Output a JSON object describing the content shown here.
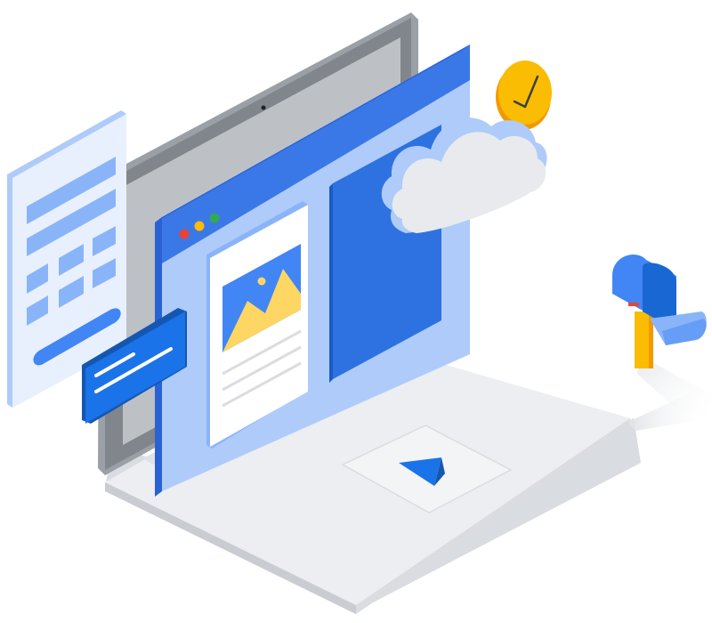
{
  "scene": {
    "subject": "isometric-laptop-illustration",
    "objects": [
      "laptop",
      "browser-window",
      "image-card",
      "cloud",
      "clock",
      "form-panel",
      "message-card",
      "mailbox",
      "touchpad-play-button"
    ]
  },
  "palette": {
    "background": "#ffffff",
    "laptop_base": "#eceef1",
    "laptop_base_shadow": "#d9dce1",
    "screen_bezel": "#80868b",
    "screen_bezel_light": "#bdc1c6",
    "window_frame": "#3b78e7",
    "window_frame_dark": "#2a62d4",
    "window_light": "#aecbfa",
    "card_white": "#ffffff",
    "image_blue": "#4285f4",
    "image_mountain": "#fdd663",
    "cloud": "#e8eaed",
    "cloud_edge": "#aecbfa",
    "clock": "#fbbc04",
    "clock_light": "#fdd663",
    "form_bg": "#e8f0fe",
    "form_blocks": "#8ab4f8",
    "message_card": "#1a73e8",
    "mailbox": "#4285f4",
    "mailbox_dark": "#1967d2",
    "mailbox_post": "#fbbc04",
    "dot_red": "#ea4335",
    "dot_yellow": "#fbbc04",
    "dot_green": "#34a853",
    "play_icon": "#1a73e8"
  }
}
